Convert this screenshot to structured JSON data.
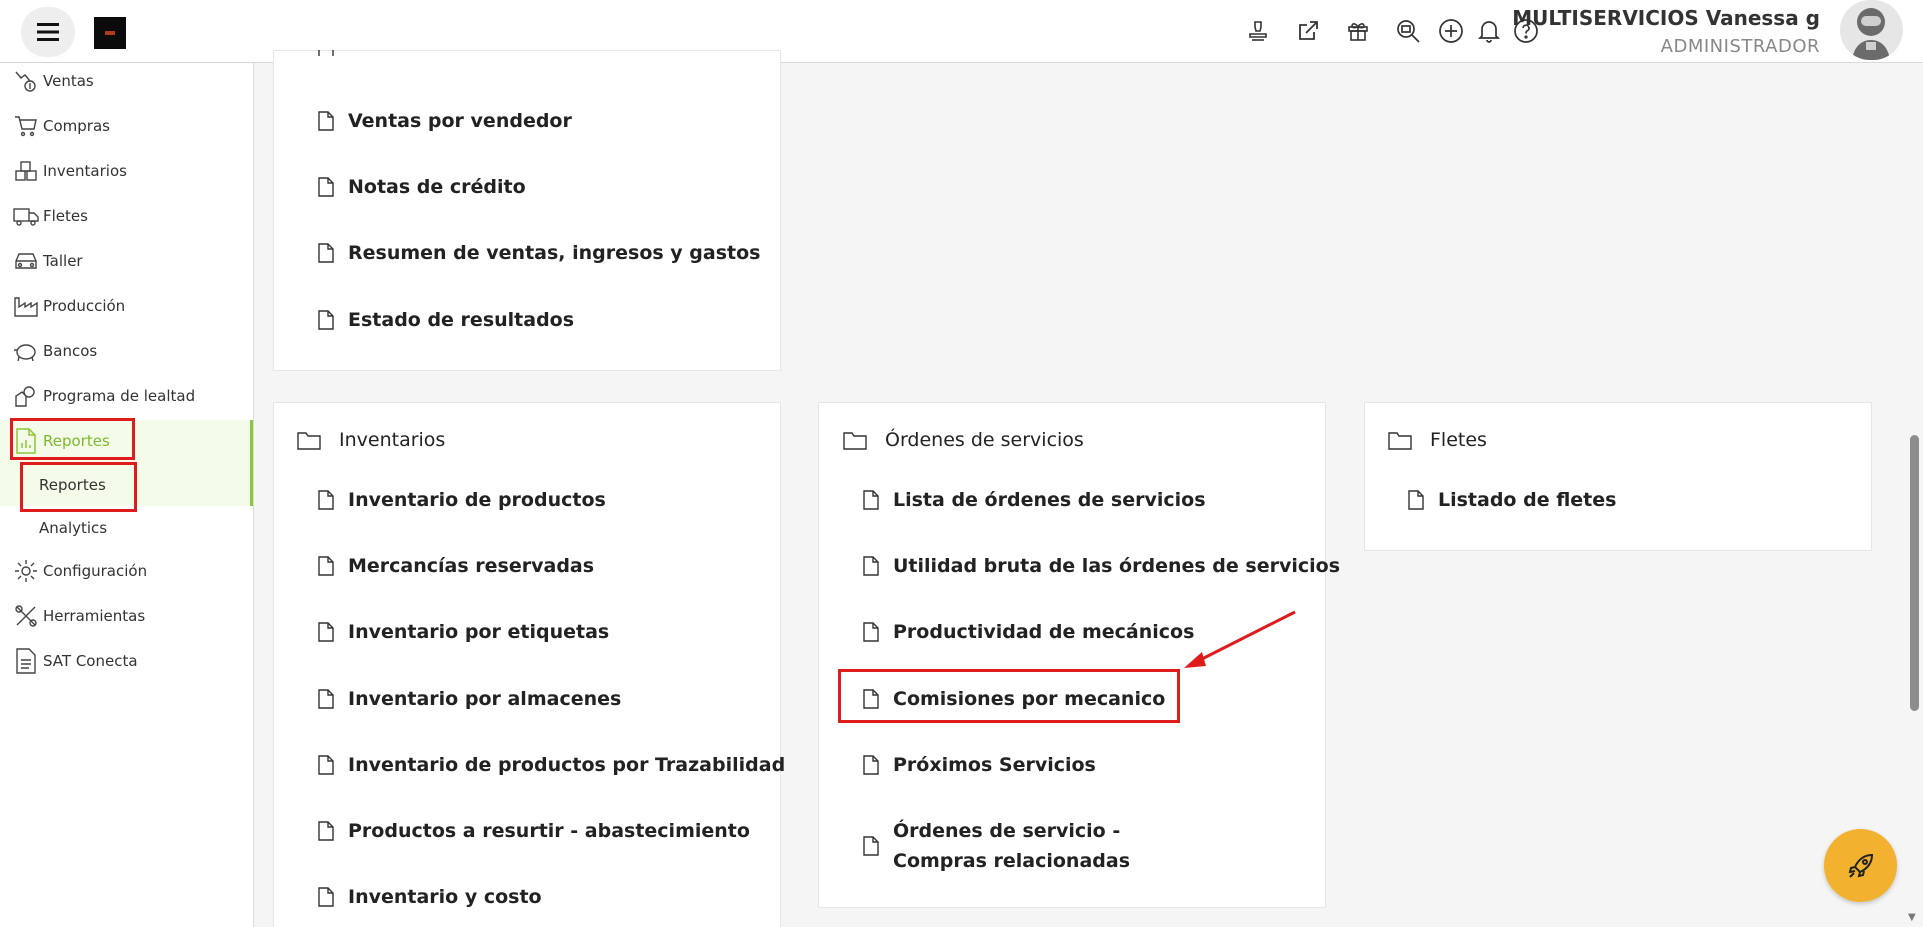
{
  "header": {
    "company": "MULTISERVICIOS Vanessa g",
    "role": "ADMINISTRADOR",
    "icons": [
      "stamp-icon",
      "external-link-icon",
      "gift-icon",
      "search-zoom-icon",
      "plus-circle-icon",
      "bell-icon",
      "help-icon"
    ]
  },
  "sidebar": {
    "items": [
      {
        "label": "Ventas",
        "icon": "sales-icon"
      },
      {
        "label": "Compras",
        "icon": "cart-icon"
      },
      {
        "label": "Inventarios",
        "icon": "boxes-icon"
      },
      {
        "label": "Fletes",
        "icon": "truck-icon"
      },
      {
        "label": "Taller",
        "icon": "car-icon"
      },
      {
        "label": "Producción",
        "icon": "factory-icon"
      },
      {
        "label": "Bancos",
        "icon": "piggy-bank-icon"
      },
      {
        "label": "Programa de lealtad",
        "icon": "loyalty-icon"
      },
      {
        "label": "Reportes",
        "icon": "report-icon"
      },
      {
        "label": "Configuración",
        "icon": "gear-icon"
      },
      {
        "label": "Herramientas",
        "icon": "tools-icon"
      },
      {
        "label": "SAT Conecta",
        "icon": "document-icon"
      }
    ],
    "sub_items": [
      "Reportes",
      "Analytics"
    ],
    "accent": "#8dc63f"
  },
  "ventas_card": {
    "links": [
      "Ventas por vendedor",
      "Notas de crédito",
      "Resumen de ventas, ingresos y gastos",
      "Estado de resultados"
    ]
  },
  "inventarios_card": {
    "title": "Inventarios",
    "links": [
      "Inventario de productos",
      "Mercancías reservadas",
      "Inventario por etiquetas",
      "Inventario por almacenes",
      "Inventario de productos por Trazabilidad",
      "Productos a resurtir - abastecimiento",
      "Inventario y costo"
    ]
  },
  "ordenes_card": {
    "title": "Órdenes de servicios",
    "links": [
      "Lista de órdenes de servicios",
      "Utilidad bruta de las órdenes de servicios",
      "Productividad de mecánicos",
      "Comisiones por mecanico",
      "Próximos Servicios",
      "Órdenes de servicio - Compras relacionadas"
    ]
  },
  "fletes_card": {
    "title": "Fletes",
    "links": [
      "Listado de fletes"
    ]
  },
  "highlight_color": "#e01b1b",
  "fab_color": "#f2b230"
}
